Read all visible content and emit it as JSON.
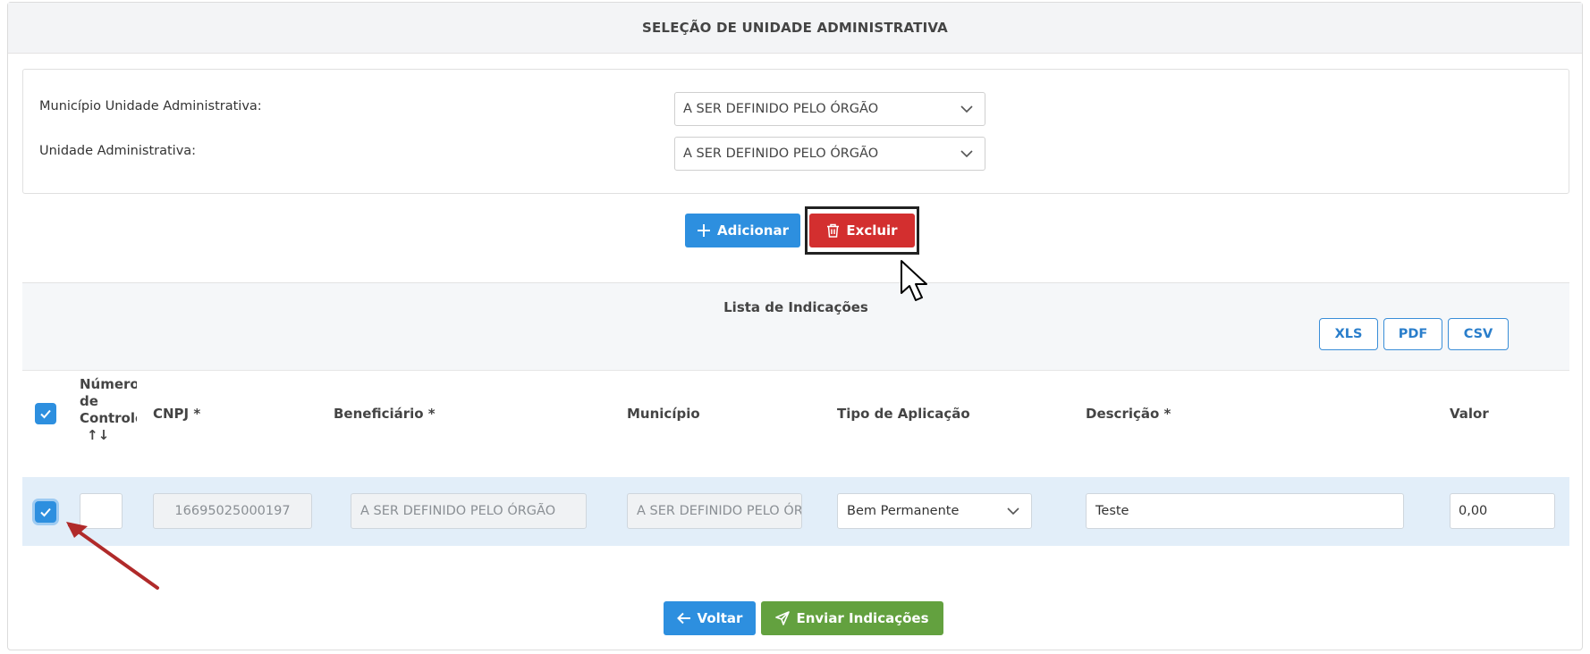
{
  "header": {
    "title": "SELEÇÃO DE UNIDADE ADMINISTRATIVA"
  },
  "selection": {
    "municipio_label": "Município Unidade Administrativa:",
    "municipio_value": "A SER DEFINIDO PELO ÓRGÃO",
    "unidade_label": "Unidade Administrativa:",
    "unidade_value": "A SER DEFINIDO PELO ÓRGÃO"
  },
  "actions": {
    "add_label": "Adicionar",
    "delete_label": "Excluir"
  },
  "list": {
    "title": "Lista de Indicações",
    "exports": [
      "XLS",
      "PDF",
      "CSV"
    ],
    "columns": {
      "numero_line1": "Número",
      "numero_line2": "de",
      "numero_line3": "Controle",
      "sort_icon": "↑↓",
      "cnpj": "CNPJ *",
      "beneficiario": "Beneficiário *",
      "municipio": "Município",
      "tipo": "Tipo de Aplicação",
      "descricao": "Descrição *",
      "valor": "Valor"
    },
    "rows": [
      {
        "numero": "",
        "cnpj": "16695025000197",
        "beneficiario": "A SER DEFINIDO PELO ÓRGÃO",
        "municipio": "A SER DEFINIDO PELO ÓRGÃO",
        "tipo": "Bem Permanente",
        "descricao": "Teste",
        "valor": "0,00",
        "selected": true
      }
    ]
  },
  "footer": {
    "back_label": "Voltar",
    "send_label": "Enviar Indicações"
  },
  "colors": {
    "primary": "#2d8fdf",
    "danger": "#d32f2f",
    "success": "#63a13f",
    "row_selected": "#e2eef9",
    "annotation_arrow": "#b02a2a"
  },
  "icons": [
    "plus-icon",
    "trash-icon",
    "chevron-down-icon",
    "check-icon",
    "arrow-left-icon",
    "paper-plane-icon",
    "mouse-cursor-icon",
    "annotation-arrow"
  ]
}
